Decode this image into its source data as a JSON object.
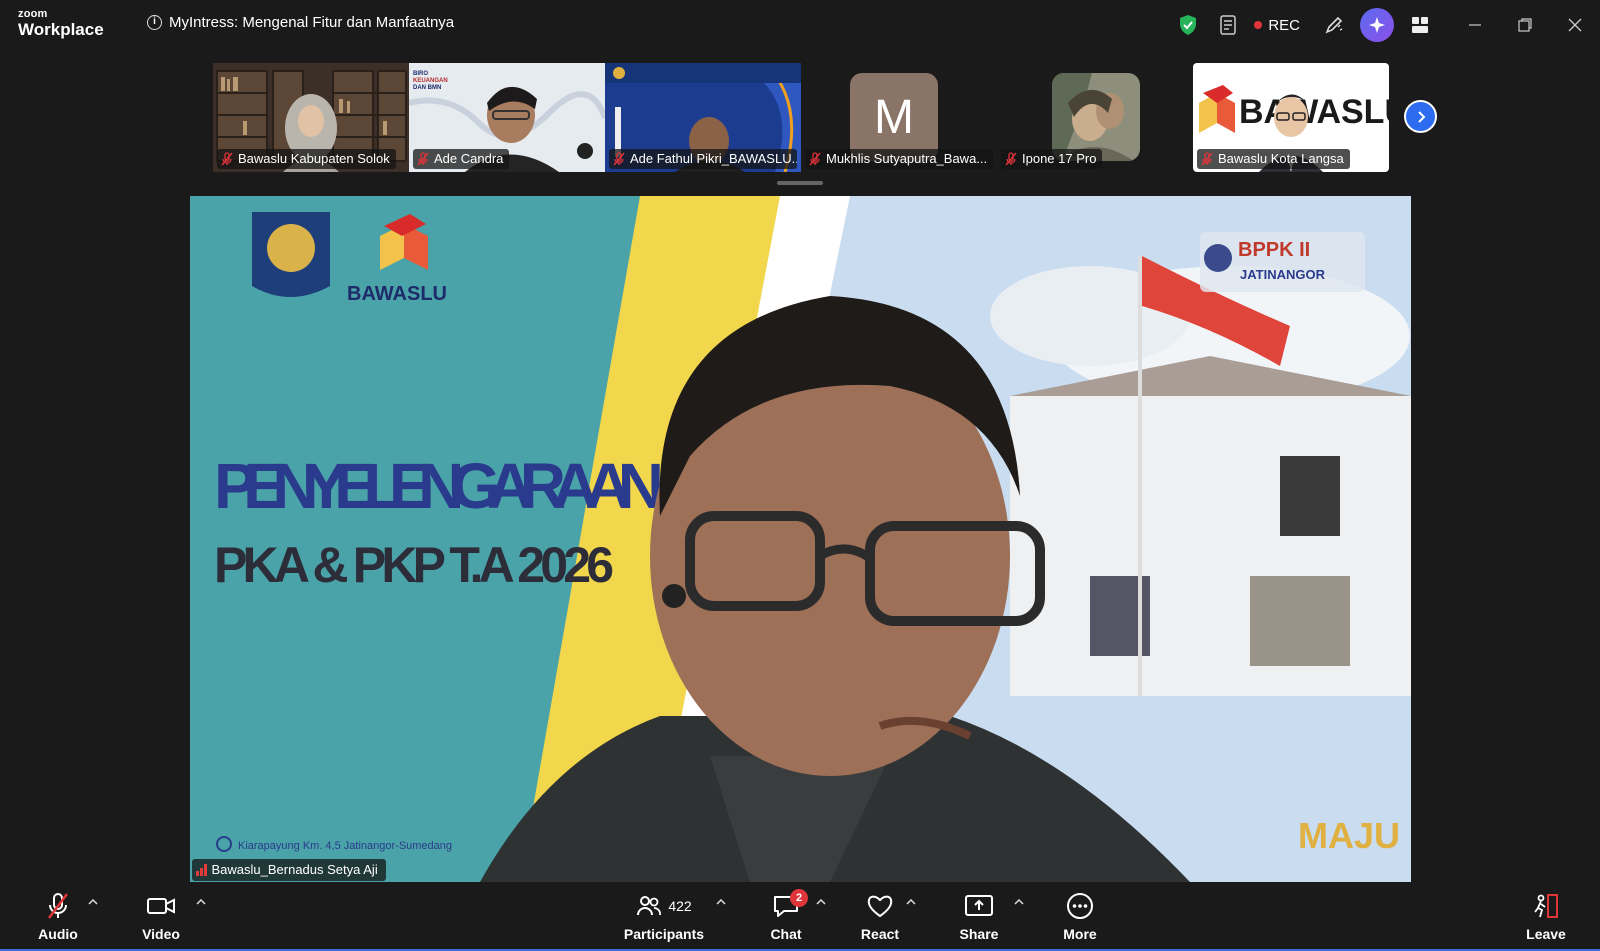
{
  "app": {
    "brand_top": "zoom",
    "brand_bottom": "Workplace"
  },
  "meeting": {
    "title": "MyIntress: Mengenal Fitur dan Manfaatnya"
  },
  "titlebar": {
    "rec_label": "REC"
  },
  "thumbnails": [
    {
      "name": "Bawaslu Kabupaten Solok"
    },
    {
      "name": "Ade Candra"
    },
    {
      "name": "Ade Fathul Pikri_BAWASLU..."
    },
    {
      "name": "Mukhlis Sutyaputra_Bawa...",
      "avatar_letter": "M"
    },
    {
      "name": "Ipone 17 Pro"
    },
    {
      "name": "Bawaslu Kota Langsa"
    }
  ],
  "main": {
    "speaker": "Bawaslu_Bernadus Setya Aji",
    "slide": {
      "logo_text": "BAWASLU",
      "title_line1": "PENYELENGARAAN",
      "title_line2": "PKA & PKP T.A 2026",
      "badge_top": "BPPK II",
      "badge_bottom": "JATINANGOR",
      "footer": "Kiarapayung Km. 4,5 Jatinangor-Sumedang",
      "corner": "MAJU"
    },
    "langsa_logo_text": "BAWASLU"
  },
  "toolbar": {
    "audio": "Audio",
    "video": "Video",
    "participants": "Participants",
    "participants_count": "422",
    "chat": "Chat",
    "chat_badge": "2",
    "react": "React",
    "share": "Share",
    "more": "More",
    "leave": "Leave"
  },
  "colors": {
    "accent": "#2d6cf0",
    "rec": "#e0353b",
    "slide_teal": "#4aa3a8",
    "slide_title": "#2a3a8c"
  }
}
